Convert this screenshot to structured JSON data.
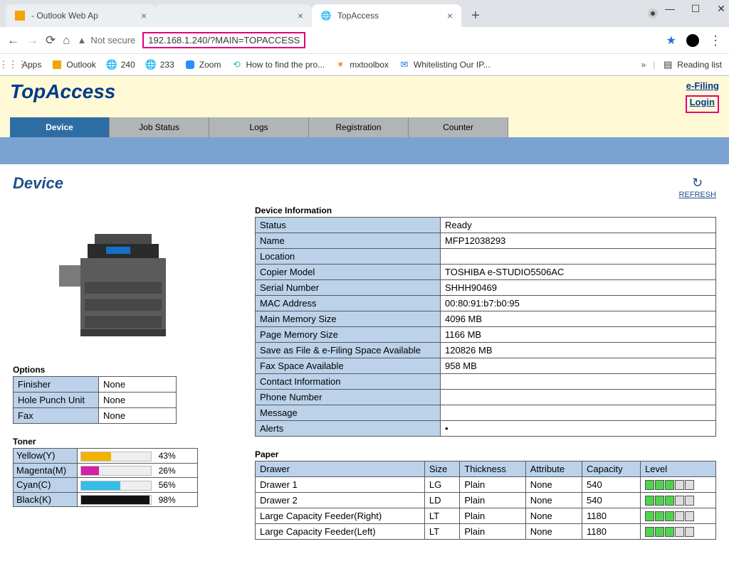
{
  "browser": {
    "tabs": [
      {
        "title": "- Outlook Web Ap",
        "favicon_color": "#f2a000"
      },
      {
        "title": "",
        "favicon": ""
      },
      {
        "title": "TopAccess",
        "favicon": "globe"
      }
    ],
    "url": "192.168.1.240/?MAIN=TOPACCESS",
    "not_secure_label": "Not secure",
    "bookmarks_label_apps": "Apps",
    "bookmarks": [
      {
        "label": "Outlook"
      },
      {
        "label": "240"
      },
      {
        "label": "233"
      },
      {
        "label": "Zoom"
      },
      {
        "label": "How to find the pro..."
      },
      {
        "label": "mxtoolbox"
      },
      {
        "label": "Whitelisting Our IP..."
      }
    ],
    "reading_list": "Reading list"
  },
  "header": {
    "logo_text": "TopAccess",
    "links": {
      "efiling": "e-Filing",
      "login": "Login"
    },
    "tabs": [
      "Device",
      "Job Status",
      "Logs",
      "Registration",
      "Counter"
    ],
    "active_tab": "Device"
  },
  "page": {
    "title": "Device",
    "refresh_label": "REFRESH"
  },
  "options_section": {
    "title": "Options",
    "rows": [
      {
        "label": "Finisher",
        "value": "None"
      },
      {
        "label": "Hole Punch Unit",
        "value": "None"
      },
      {
        "label": "Fax",
        "value": "None"
      }
    ]
  },
  "toner_section": {
    "title": "Toner",
    "rows": [
      {
        "label": "Yellow(Y)",
        "pct": 43,
        "color": "#f0b400"
      },
      {
        "label": "Magenta(M)",
        "pct": 26,
        "color": "#d61fa7"
      },
      {
        "label": "Cyan(C)",
        "pct": 56,
        "color": "#36bde8"
      },
      {
        "label": "Black(K)",
        "pct": 98,
        "color": "#111111"
      }
    ]
  },
  "device_info": {
    "title": "Device Information",
    "rows": [
      {
        "label": "Status",
        "value": "Ready"
      },
      {
        "label": "Name",
        "value": "MFP12038293"
      },
      {
        "label": "Location",
        "value": ""
      },
      {
        "label": "Copier Model",
        "value": "TOSHIBA e-STUDIO5506AC"
      },
      {
        "label": "Serial Number",
        "value": "SHHH90469"
      },
      {
        "label": "MAC Address",
        "value": "00:80:91:b7:b0:95"
      },
      {
        "label": "Main Memory Size",
        "value": "4096 MB"
      },
      {
        "label": "Page Memory Size",
        "value": "1166 MB"
      },
      {
        "label": "Save as File & e-Filing Space Available",
        "value": "120826 MB"
      },
      {
        "label": "Fax Space Available",
        "value": "958 MB"
      },
      {
        "label": "Contact Information",
        "value": ""
      },
      {
        "label": "Phone Number",
        "value": ""
      },
      {
        "label": "Message",
        "value": ""
      },
      {
        "label": "Alerts",
        "value": "•"
      }
    ]
  },
  "paper_section": {
    "title": "Paper",
    "headers": [
      "Drawer",
      "Size",
      "Thickness",
      "Attribute",
      "Capacity",
      "Level"
    ],
    "rows": [
      {
        "drawer": "Drawer 1",
        "size": "LG",
        "thick": "Plain",
        "attr": "None",
        "cap": "540",
        "level": 3
      },
      {
        "drawer": "Drawer 2",
        "size": "LD",
        "thick": "Plain",
        "attr": "None",
        "cap": "540",
        "level": 3
      },
      {
        "drawer": "Large Capacity Feeder(Right)",
        "size": "LT",
        "thick": "Plain",
        "attr": "None",
        "cap": "1180",
        "level": 3
      },
      {
        "drawer": "Large Capacity Feeder(Left)",
        "size": "LT",
        "thick": "Plain",
        "attr": "None",
        "cap": "1180",
        "level": 3
      }
    ]
  }
}
